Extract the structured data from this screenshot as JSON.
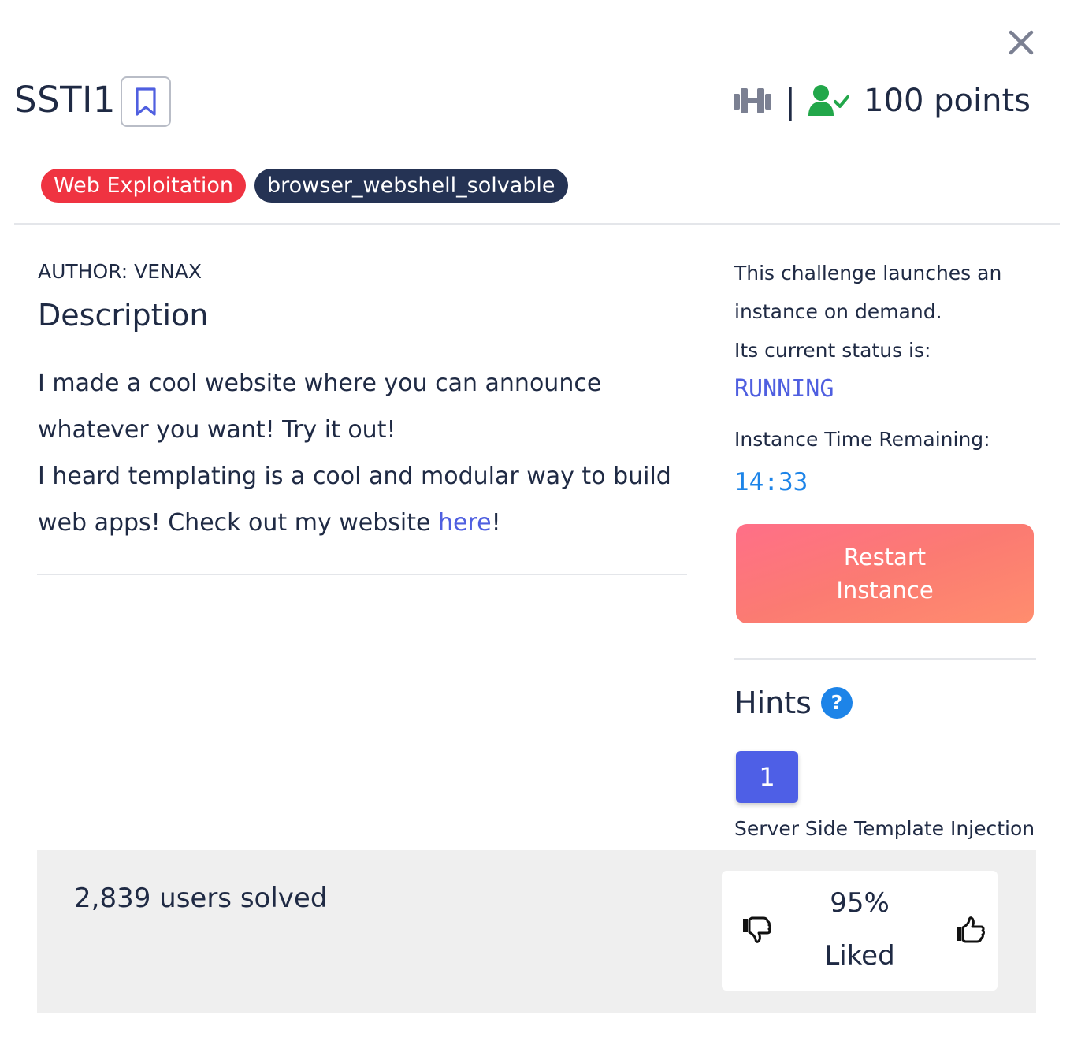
{
  "challenge": {
    "title": "SSTI1",
    "points": "100 points",
    "separator": "|",
    "tags": [
      "Web Exploitation",
      "browser_webshell_solvable"
    ]
  },
  "author": "AUTHOR: VENAX",
  "description": {
    "heading": "Description",
    "text_before_link": "I made a cool website where you can announce whatever you want! Try it out!\nI heard templating is a cool and modular way to build web apps! Check out my website ",
    "link_text": "here",
    "text_after_link": "!"
  },
  "instance": {
    "info": "This challenge launches an instance on demand.",
    "status_label": "Its current status is:",
    "status": "RUNNING",
    "time_label": "Instance Time Remaining:",
    "time_remaining": "14:33",
    "restart_label": "Restart Instance"
  },
  "hints": {
    "heading": "Hints",
    "help_icon": "?",
    "items": [
      {
        "number": "1",
        "text": "Server Side Template Injection"
      }
    ]
  },
  "stats": {
    "solved": "2,839 users solved",
    "liked_percent": "95%",
    "liked_label": "Liked"
  },
  "icons": {
    "close": "close-icon",
    "bookmark": "bookmark-icon",
    "difficulty": "dumbbell-icon",
    "solved": "user-check-icon",
    "help": "question-circle-icon",
    "thumb_down": "thumbs-down-icon",
    "thumb_up": "thumbs-up-icon"
  },
  "colors": {
    "accent": "#4f5fe0",
    "tag_category": "#ef3341",
    "tag_dark": "#253354",
    "timer": "#1d84e8",
    "solved_icon": "#22a74a",
    "restart_button": "#fb7b72"
  }
}
